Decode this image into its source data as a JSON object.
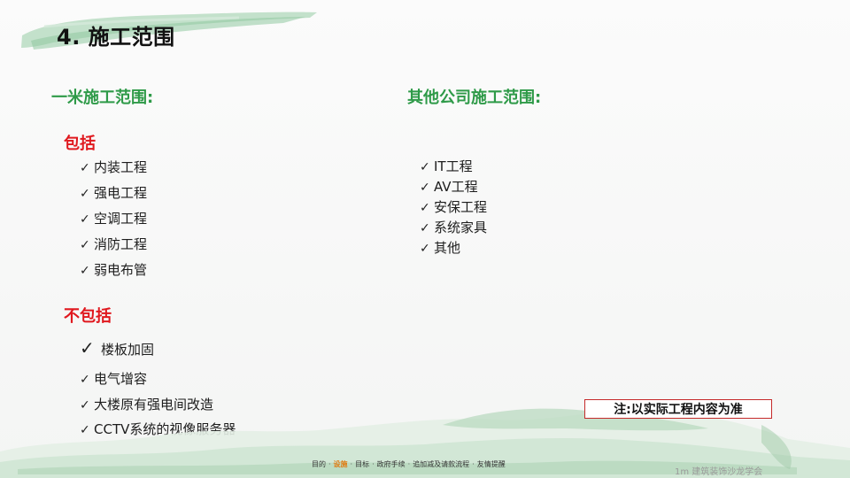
{
  "slide": {
    "title": "4. 施工范围"
  },
  "left_column": {
    "heading": "一米施工范围:",
    "include_label": "包括",
    "include_items": [
      "内装工程",
      "强电工程",
      "空调工程",
      "消防工程",
      "弱电布管"
    ],
    "exclude_label": "不包括",
    "exclude_items": [
      "楼板加固",
      "电气增容",
      "大楼原有强电间改造",
      "CCTV系统的视像服务器"
    ]
  },
  "right_column": {
    "heading": "其他公司施工范围:",
    "items": [
      "IT工程",
      "AV工程",
      "安保工程",
      "系统家具",
      "其他"
    ]
  },
  "note": "注:以实际工程内容为准",
  "footer": {
    "nav": [
      "目的",
      "设施",
      "目标",
      "政府手续",
      "追加减及请款流程",
      "友情提醒"
    ],
    "active_index": 1,
    "brand": "1m 建筑装饰沙龙学会"
  },
  "colors": {
    "heading_green": "#2e9a48",
    "label_red": "#e0181e",
    "note_border": "#c52a2a",
    "footer_active": "#e07a10"
  },
  "icons": {
    "bullet": "check-mark-icon"
  }
}
